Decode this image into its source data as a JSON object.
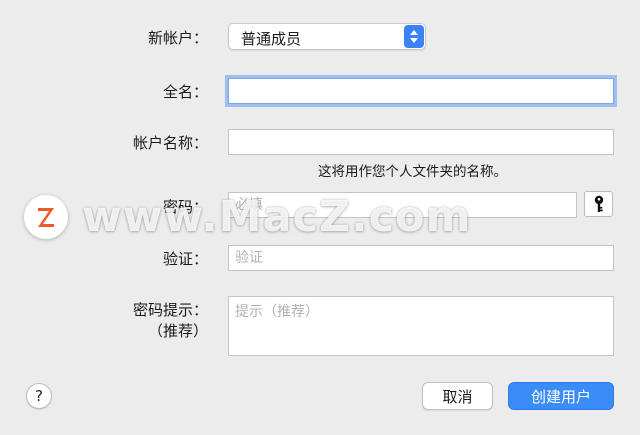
{
  "form": {
    "account_type_label": "新帐户：",
    "account_type_value": "普通成员",
    "full_name_label": "全名：",
    "full_name_value": "",
    "account_name_label": "帐户名称：",
    "account_name_value": "",
    "account_name_hint": "这将用作您个人文件夹的名称。",
    "password_label": "密码：",
    "password_placeholder": "必填",
    "verify_label": "验证：",
    "verify_placeholder": "验证",
    "password_hint_label": "密码提示：",
    "password_hint_sub": "（推荐）",
    "password_hint_placeholder": "提示（推荐）"
  },
  "footer": {
    "help_label": "?",
    "cancel_label": "取消",
    "create_label": "创建用户"
  },
  "watermark": {
    "text": "www.MacZ.com",
    "logo_letter": "Z"
  },
  "icons": {
    "account_type_arrows": "chevron-up-down-icon",
    "password_assistant": "key-icon",
    "watermark_logo": "macz-logo-icon"
  },
  "colors": {
    "accent": "#3a8cf7",
    "focus_ring": "#9dbff0",
    "logo": "#f05a28",
    "background": "#ececec"
  }
}
